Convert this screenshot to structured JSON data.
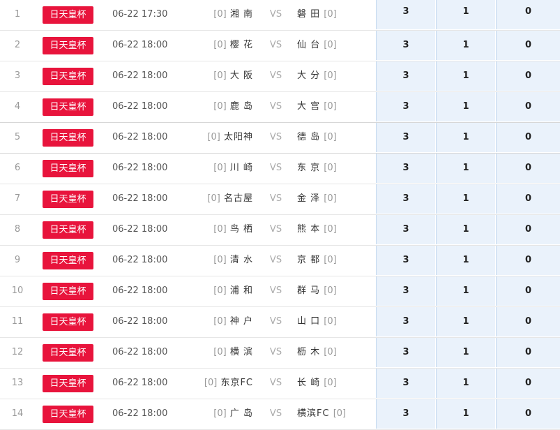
{
  "vs_label": "VS",
  "rows": [
    {
      "idx": "1",
      "league": "日天皇杯",
      "time": "06-22 17:30",
      "home_rank": "[0]",
      "home": "湘 南",
      "away": "磐 田",
      "away_rank": "[0]",
      "odds": [
        "3",
        "1",
        "0"
      ]
    },
    {
      "idx": "2",
      "league": "日天皇杯",
      "time": "06-22 18:00",
      "home_rank": "[0]",
      "home": "樱 花",
      "away": "仙 台",
      "away_rank": "[0]",
      "odds": [
        "3",
        "1",
        "0"
      ]
    },
    {
      "idx": "3",
      "league": "日天皇杯",
      "time": "06-22 18:00",
      "home_rank": "[0]",
      "home": "大 阪",
      "away": "大 分",
      "away_rank": "[0]",
      "odds": [
        "3",
        "1",
        "0"
      ]
    },
    {
      "idx": "4",
      "league": "日天皇杯",
      "time": "06-22 18:00",
      "home_rank": "[0]",
      "home": "鹿 岛",
      "away": "大 宫",
      "away_rank": "[0]",
      "odds": [
        "3",
        "1",
        "0"
      ]
    },
    {
      "idx": "5",
      "league": "日天皇杯",
      "time": "06-22 18:00",
      "home_rank": "[0]",
      "home": "太阳神",
      "away": "德 岛",
      "away_rank": "[0]",
      "odds": [
        "3",
        "1",
        "0"
      ]
    },
    {
      "idx": "6",
      "league": "日天皇杯",
      "time": "06-22 18:00",
      "home_rank": "[0]",
      "home": "川 崎",
      "away": "东 京",
      "away_rank": "[0]",
      "odds": [
        "3",
        "1",
        "0"
      ]
    },
    {
      "idx": "7",
      "league": "日天皇杯",
      "time": "06-22 18:00",
      "home_rank": "[0]",
      "home": "名古屋",
      "away": "金 泽",
      "away_rank": "[0]",
      "odds": [
        "3",
        "1",
        "0"
      ]
    },
    {
      "idx": "8",
      "league": "日天皇杯",
      "time": "06-22 18:00",
      "home_rank": "[0]",
      "home": "鸟 栖",
      "away": "熊 本",
      "away_rank": "[0]",
      "odds": [
        "3",
        "1",
        "0"
      ]
    },
    {
      "idx": "9",
      "league": "日天皇杯",
      "time": "06-22 18:00",
      "home_rank": "[0]",
      "home": "清 水",
      "away": "京 都",
      "away_rank": "[0]",
      "odds": [
        "3",
        "1",
        "0"
      ]
    },
    {
      "idx": "10",
      "league": "日天皇杯",
      "time": "06-22 18:00",
      "home_rank": "[0]",
      "home": "浦 和",
      "away": "群 马",
      "away_rank": "[0]",
      "odds": [
        "3",
        "1",
        "0"
      ]
    },
    {
      "idx": "11",
      "league": "日天皇杯",
      "time": "06-22 18:00",
      "home_rank": "[0]",
      "home": "神 户",
      "away": "山 口",
      "away_rank": "[0]",
      "odds": [
        "3",
        "1",
        "0"
      ]
    },
    {
      "idx": "12",
      "league": "日天皇杯",
      "time": "06-22 18:00",
      "home_rank": "[0]",
      "home": "横 滨",
      "away": "枥 木",
      "away_rank": "[0]",
      "odds": [
        "3",
        "1",
        "0"
      ]
    },
    {
      "idx": "13",
      "league": "日天皇杯",
      "time": "06-22 18:00",
      "home_rank": "[0]",
      "home": "东京FC",
      "away": "长 崎",
      "away_rank": "[0]",
      "odds": [
        "3",
        "1",
        "0"
      ]
    },
    {
      "idx": "14",
      "league": "日天皇杯",
      "time": "06-22 18:00",
      "home_rank": "[0]",
      "home": "广 岛",
      "away": "横滨FC",
      "away_rank": "[0]",
      "odds": [
        "3",
        "1",
        "0"
      ]
    }
  ],
  "colors": {
    "league_badge": "#e8143c",
    "odds_cell_bg": "#eaf2fb",
    "odds_cell_border": "#c5d9ef"
  }
}
